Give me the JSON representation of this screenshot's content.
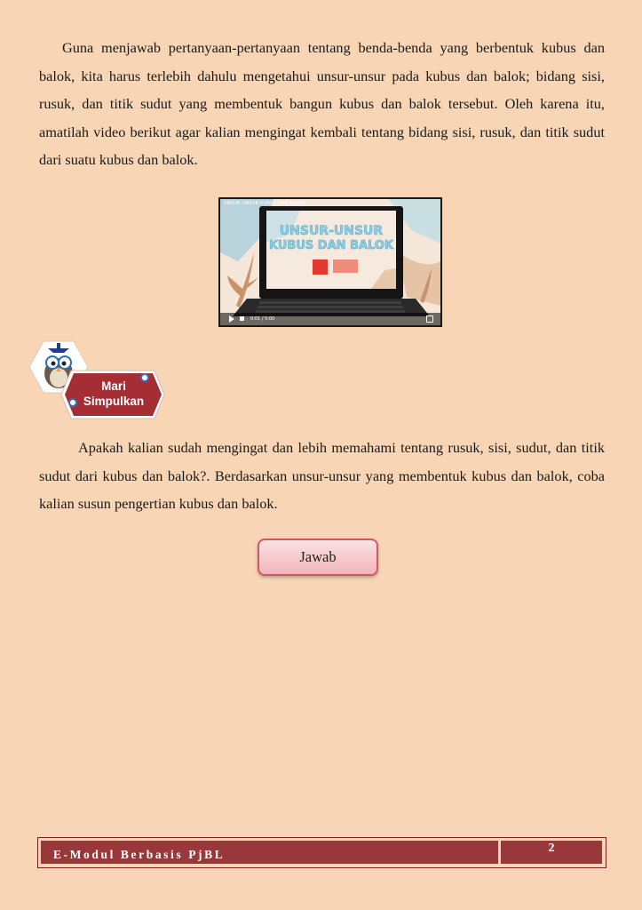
{
  "intro": {
    "paragraph": "Guna menjawab pertanyaan-pertanyaan tentang benda-benda yang berbentuk kubus dan balok, kita harus terlebih dahulu mengetahui unsur-unsur pada kubus dan balok; bidang sisi, rusuk, dan titik sudut yang membentuk bangun kubus dan balok tersebut. Oleh karena itu, amatilah video berikut agar kalian mengingat kembali tentang bidang sisi, rusuk, dan titik sudut dari suatu kubus dan balok."
  },
  "video": {
    "top_title": "UNSUR UNSUR KUBUS DAN BALOK",
    "screen_title_line1": "UNSUR-UNSUR",
    "screen_title_line2": "KUBUS DAN BALOK",
    "time": "0:01 / 5:00"
  },
  "section_badge": {
    "line1": "Mari",
    "line2": "Simpulkan"
  },
  "conclusion": {
    "paragraph": "Apakah kalian sudah mengingat dan lebih memahami tentang rusuk, sisi, sudut, dan titik sudut dari kubus dan balok?. Berdasarkan unsur-unsur yang membentuk kubus dan balok, coba kalian susun pengertian kubus dan balok."
  },
  "answer_button": {
    "label": "Jawab"
  },
  "footer": {
    "title": "E-Modul Berbasis PjBL",
    "page_number": "2"
  }
}
